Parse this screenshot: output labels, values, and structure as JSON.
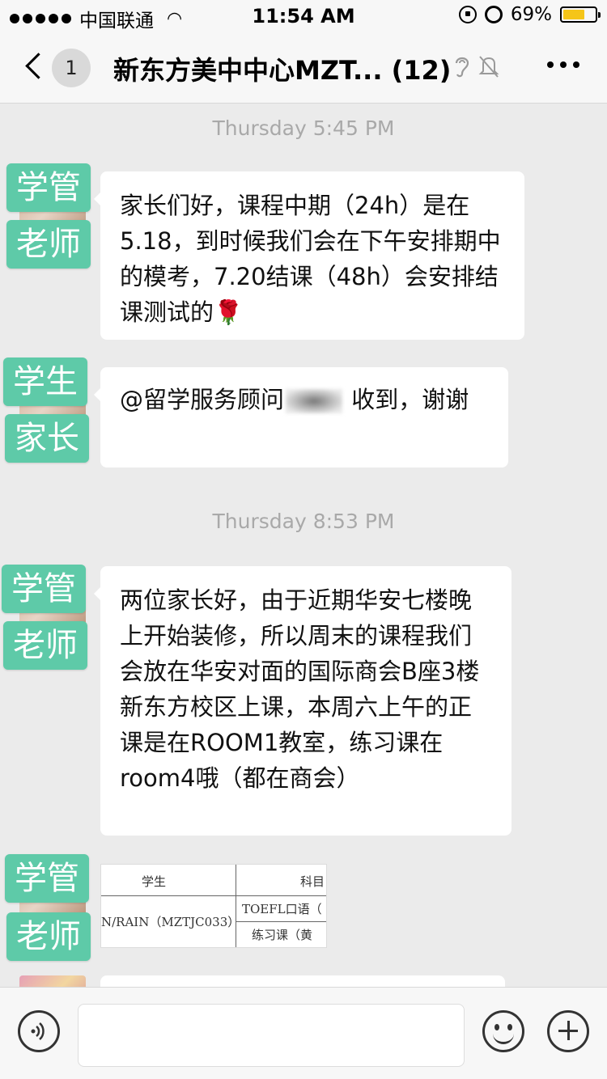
{
  "status_bar": {
    "carrier": "中国联通",
    "time": "11:54 AM",
    "battery_percent": "69%",
    "battery_level": 0.69,
    "icons": [
      "signal-dots-icon",
      "wifi-icon",
      "orientation-lock-icon",
      "alarm-icon",
      "battery-icon"
    ]
  },
  "nav": {
    "unread_count": "1",
    "title": "新东方美中中心MZT... (12)",
    "icons": [
      "back-chevron-icon",
      "ear-icon",
      "mute-bell-icon",
      "more-icon"
    ]
  },
  "chat": {
    "time_labels": [
      "Thursday 5:45 PM",
      "Thursday 8:53 PM"
    ],
    "messages": [
      {
        "tag_line1": "学管",
        "tag_line2": "老师",
        "text": "家长们好，课程中期（24h）是在5.18，到时候我们会在下午安排期中的模考，7.20结课（48h）会安排结课测试的",
        "emoji": "🌹"
      },
      {
        "tag_line1": "学生",
        "tag_line2": "家长",
        "mention": "@留学服务顾问",
        "text": " 收到，谢谢"
      },
      {
        "tag_line1": "学管",
        "tag_line2": "老师",
        "text": "两位家长好，由于近期华安七楼晚上开始装修，所以周末的课程我们会放在华安对面的国际商会B座3楼新东方校区上课，本周六上午的正课是在ROOM1教室，练习课在room4哦（都在商会）"
      },
      {
        "tag_line1": "学管",
        "tag_line2": "老师",
        "image": {
          "header_student": "学生",
          "header_subject": "科目",
          "student_cell": "N/RAIN（MZTJC033）",
          "subject_row1": "TOEFL口语（",
          "subject_row2": "练习课（黄"
        }
      }
    ]
  },
  "input_bar": {
    "placeholder": "",
    "icons": [
      "voice-icon",
      "emoji-icon",
      "plus-icon"
    ]
  },
  "colors": {
    "tag_green": "#5ecaa8",
    "chat_bg": "#ebebeb",
    "battery_yellow": "#f5c518"
  }
}
